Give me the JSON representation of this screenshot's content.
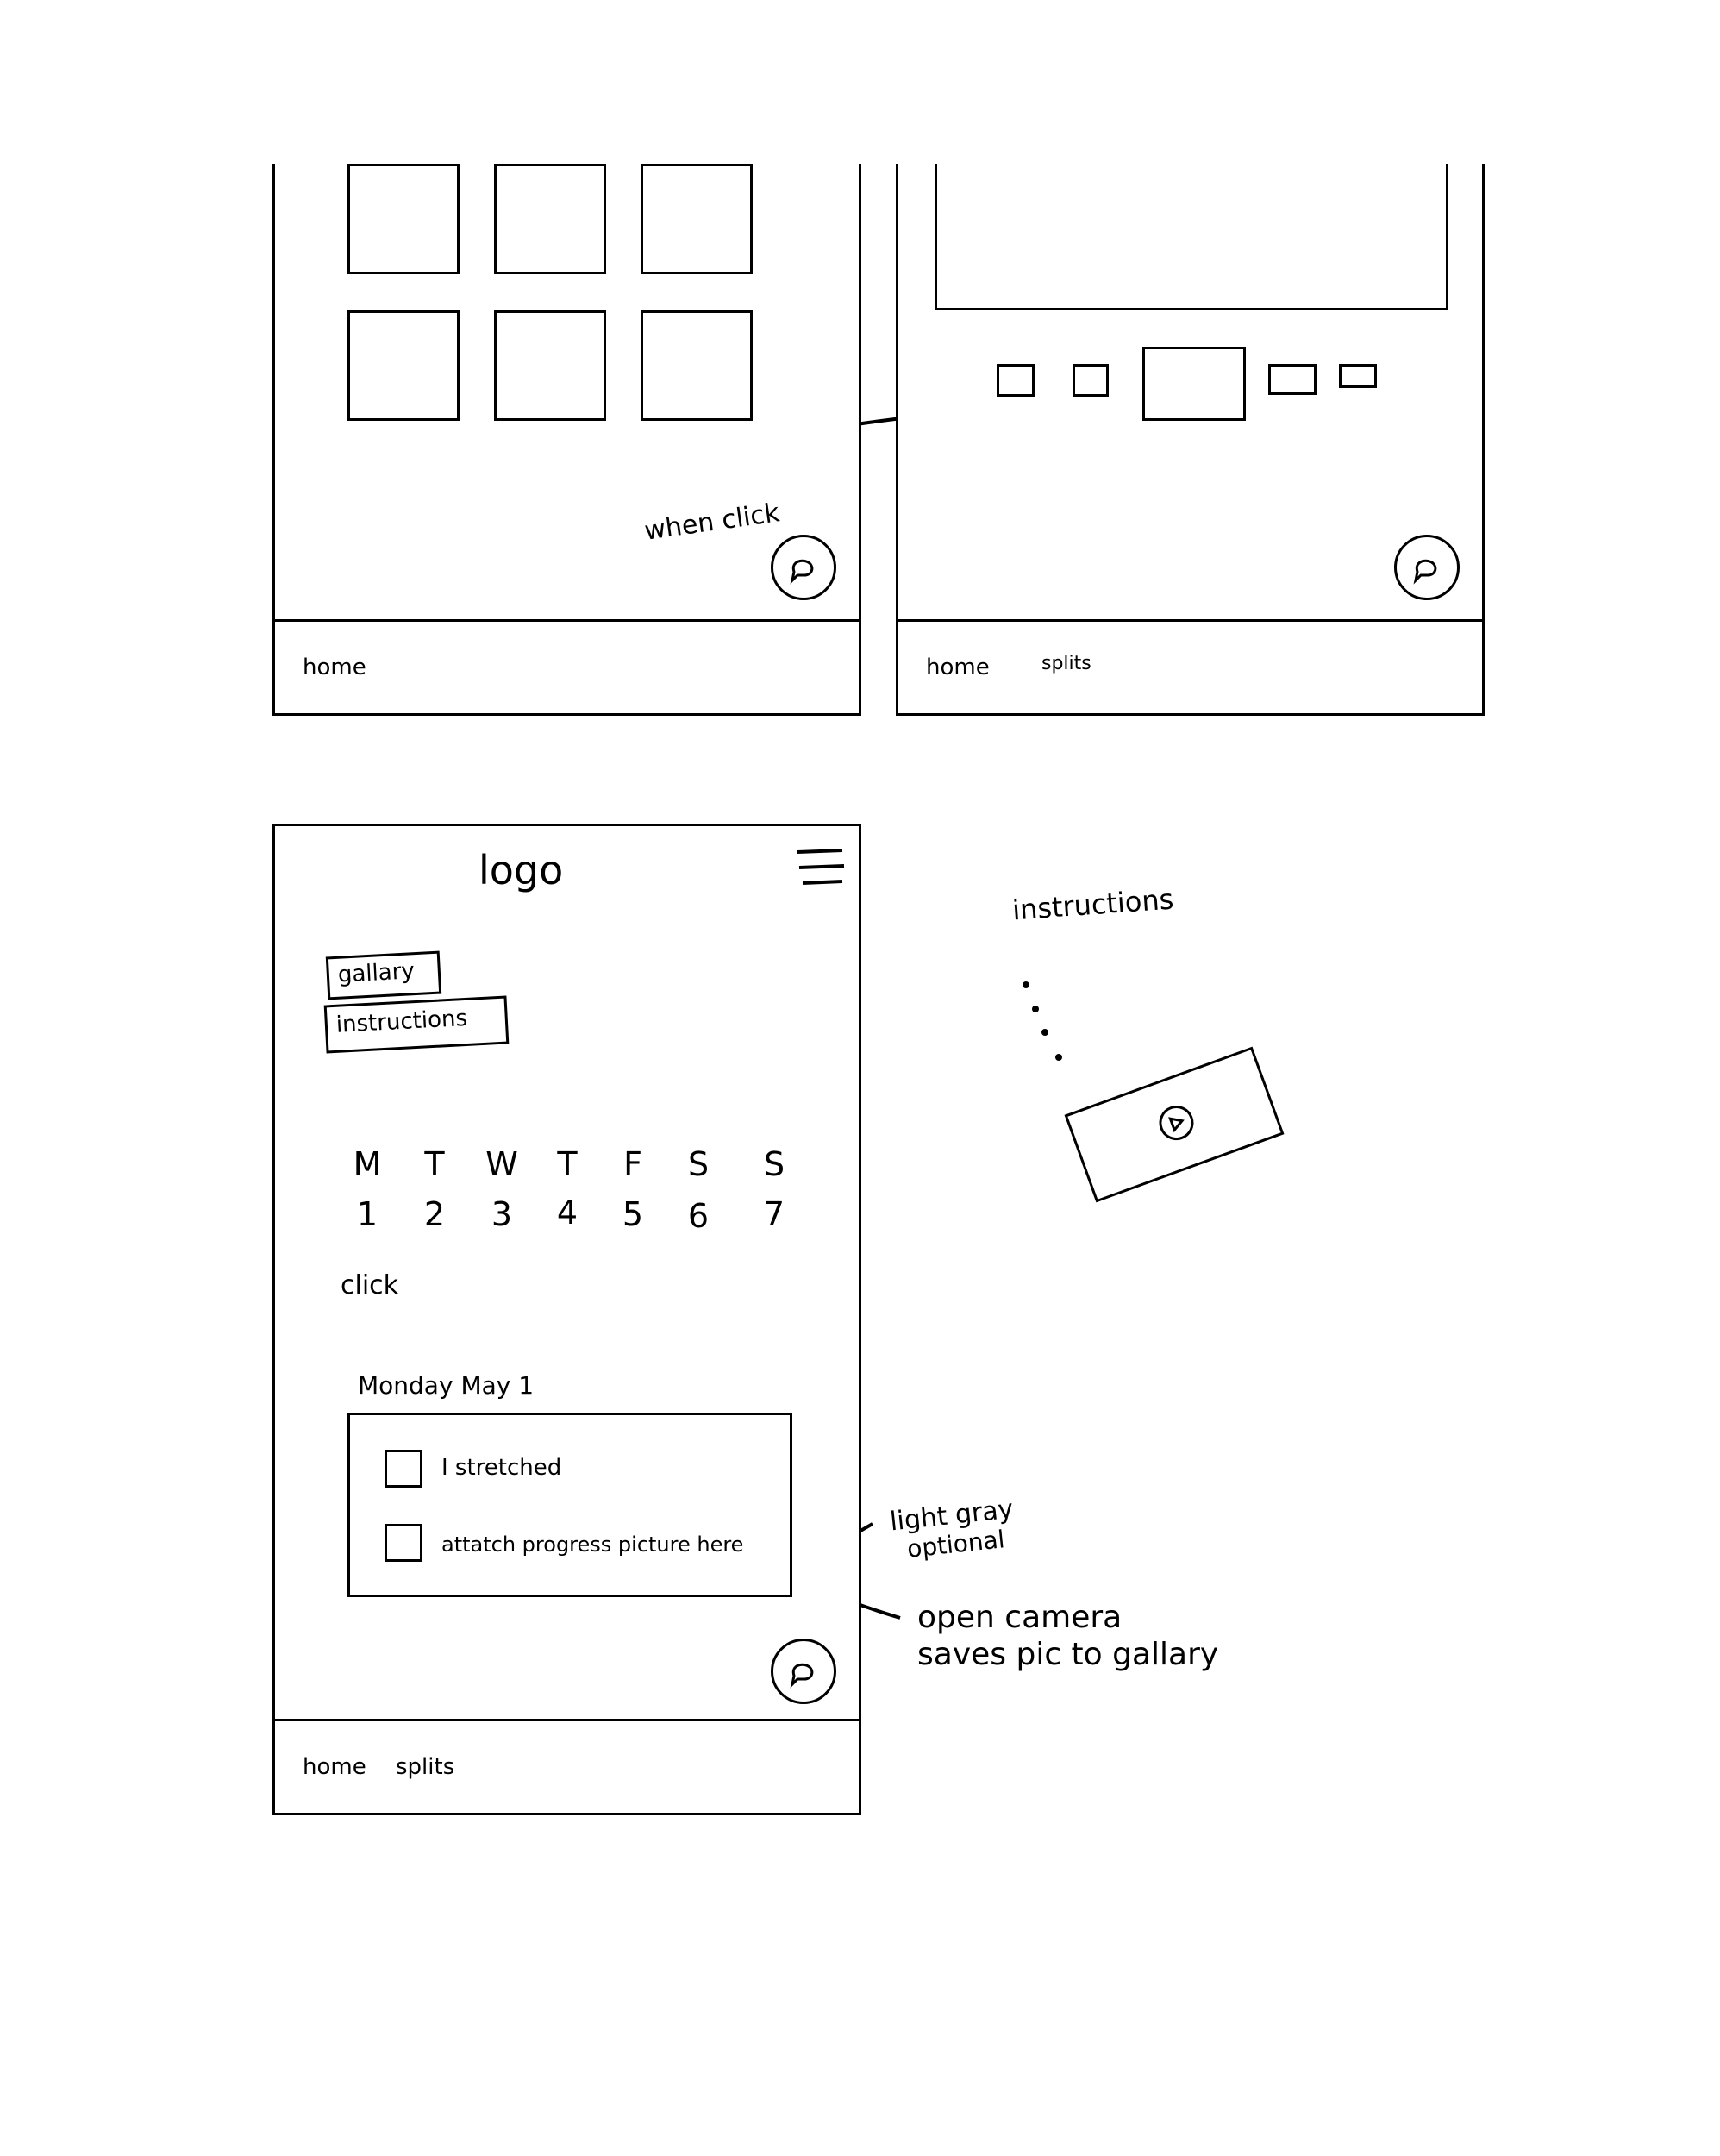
{
  "screen_gallery": {
    "annotation": "when click",
    "nav": {
      "home": "home"
    }
  },
  "screen_viewer": {
    "nav": {
      "home": "home",
      "splits": "splits"
    }
  },
  "screen_main": {
    "logo": "logo",
    "buttons": {
      "gallery": "gallary",
      "instructions": "instructions"
    },
    "calendar": {
      "days": [
        "M",
        "T",
        "W",
        "T",
        "F",
        "S",
        "S"
      ],
      "dates": [
        "1",
        "2",
        "3",
        "4",
        "5",
        "6",
        "7"
      ],
      "click_note": "click"
    },
    "selected_date": "Monday May 1",
    "tasks": [
      {
        "label": "I stretched"
      },
      {
        "label": "attatch progress picture here"
      }
    ],
    "nav": {
      "home": "home",
      "splits": "splits"
    }
  },
  "annotations": {
    "hint_color_1": "light gray",
    "hint_color_2": "optional",
    "camera_1": "open camera",
    "camera_2": "saves pic to gallary"
  },
  "instructions_panel": {
    "title": "instructions",
    "icon": "play-icon"
  }
}
